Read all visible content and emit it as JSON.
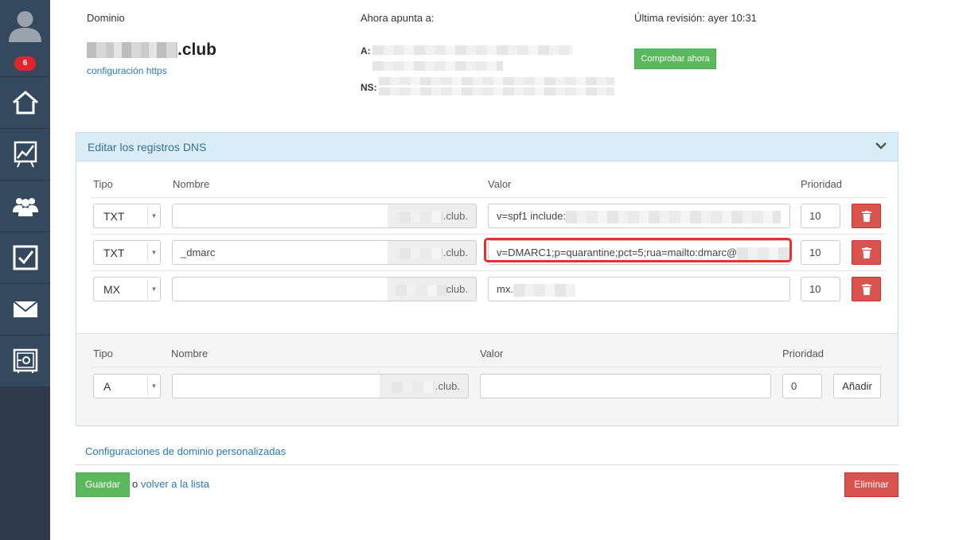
{
  "sidebar": {
    "badge": "6",
    "items": [
      {
        "icon": "home-icon"
      },
      {
        "icon": "chart-icon"
      },
      {
        "icon": "users-icon"
      },
      {
        "icon": "checkbox-icon"
      },
      {
        "icon": "mail-icon"
      },
      {
        "icon": "safe-icon"
      }
    ]
  },
  "domain": {
    "label": "Dominio",
    "tld": ".club",
    "https_link": "configuración https",
    "points_to_label": "Ahora apunta a:",
    "a_label": "A:",
    "ns_label": "NS:",
    "last_review": "Última revisión: ayer 10:31",
    "check_button": "Comprobar ahora"
  },
  "dns_panel": {
    "title": "Editar los registros DNS",
    "headers": {
      "type": "Tipo",
      "name": "Nombre",
      "value": "Valor",
      "priority": "Prioridad"
    },
    "records": [
      {
        "type": "TXT",
        "name": "",
        "suffix": ".club.",
        "value": "v=spf1 include:",
        "priority": "10"
      },
      {
        "type": "TXT",
        "name": "_dmarc",
        "suffix": ".club.",
        "value": "v=DMARC1;p=quarantine;pct=5;rua=mailto:dmarc@",
        "priority": "10"
      },
      {
        "type": "MX",
        "name": "",
        "suffix": "club.",
        "value": "mx.",
        "priority": "10"
      }
    ],
    "new_record": {
      "headers": {
        "type": "Tipo",
        "name": "Nombre",
        "value": "Valor",
        "priority": "Prioridad"
      },
      "type": "A",
      "name": "",
      "suffix": ".club.",
      "value": "",
      "priority": "0",
      "add_button": "Añadir"
    }
  },
  "footer": {
    "custom_settings_link": "Configuraciones de dominio personalizadas",
    "save_button": "Guardar",
    "or_text": "o",
    "back_link": "volver a la lista",
    "delete_button": "Eliminar"
  },
  "colors": {
    "sidebar": "#34495e",
    "success": "#5cb85c",
    "danger": "#d9534f",
    "panel_head": "#d9edf7",
    "highlight": "#e03030",
    "link": "#2a7ab0"
  }
}
